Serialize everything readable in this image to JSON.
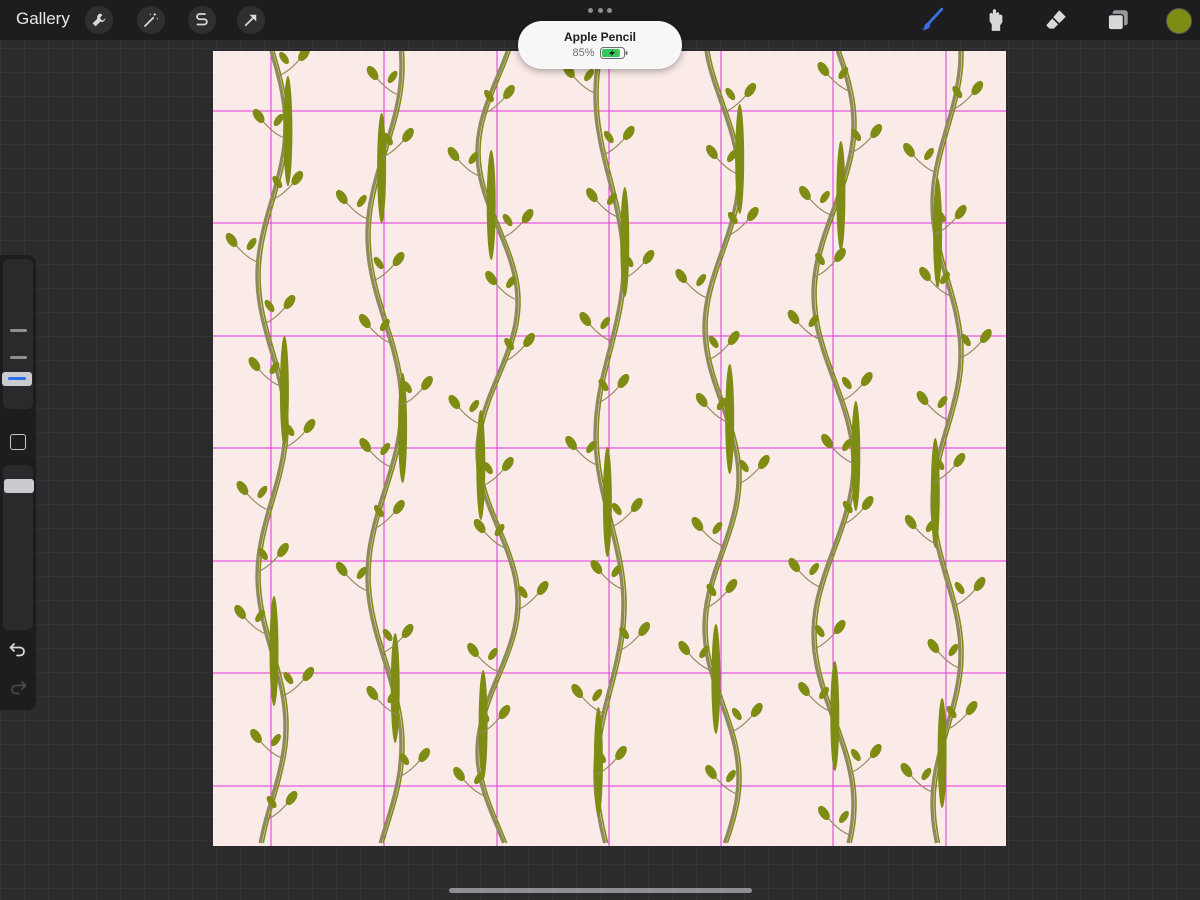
{
  "topbar": {
    "gallery_label": "Gallery",
    "left_tools": [
      "wrench-icon",
      "magic-wand-icon",
      "selection-icon",
      "transform-arrow-icon"
    ],
    "right_tools": [
      "brush-icon",
      "smudge-icon",
      "eraser-icon",
      "layers-icon"
    ],
    "current_color": "#7e8c14",
    "brush_color": "#3b6fe0"
  },
  "pencil_status": {
    "title": "Apple Pencil",
    "battery_percent": "85%",
    "battery_level": 0.85
  },
  "canvas": {
    "background": "#fbebe8",
    "guide_color": "#e033e0",
    "vine_color": "#7e8c14",
    "stem_color": "#8f8a5c"
  },
  "sidebar": {
    "brush_size_level": 0.22,
    "opacity_level": 0.1
  }
}
